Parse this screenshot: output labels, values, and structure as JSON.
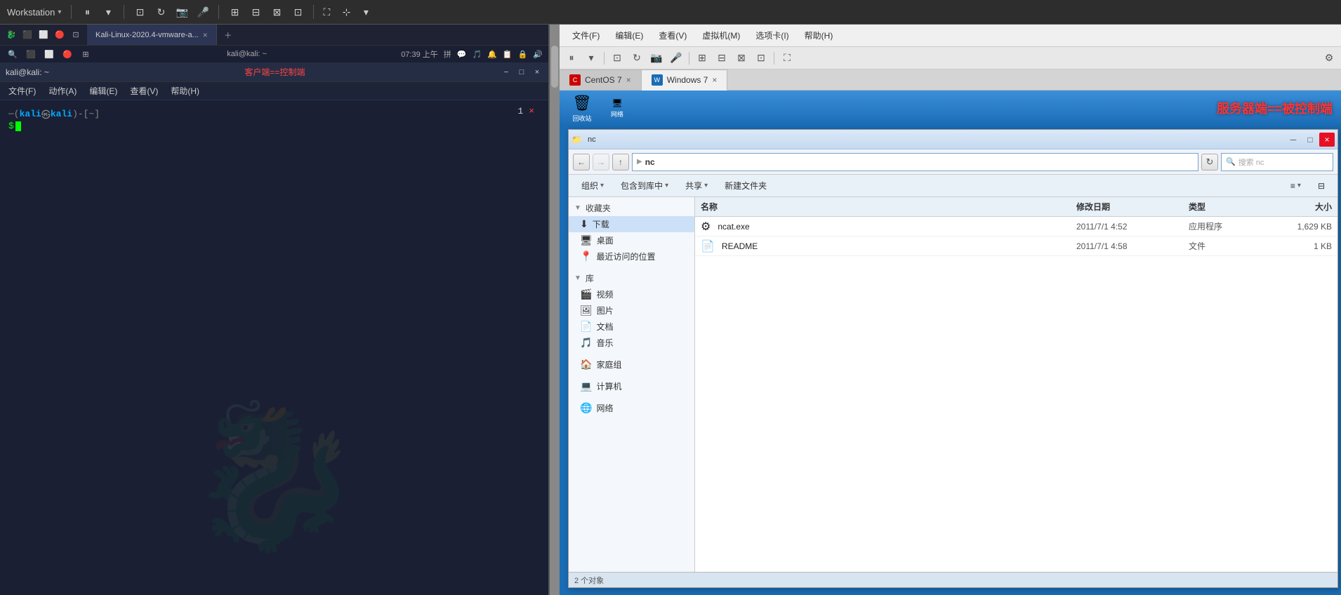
{
  "app": {
    "title": "Workstation",
    "dropdown_arrow": "▾"
  },
  "left_panel": {
    "tab_label": "Kali-Linux-2020.4-vmware-a...",
    "tab_close": "×",
    "status_bar": {
      "left_icons": [
        "⬛",
        "⬜",
        "⬜",
        "🔴"
      ],
      "time": "07:39 上午",
      "input_label": "拼",
      "right_icons": [
        "💬",
        "🎵",
        "🔔",
        "📋",
        "🔒",
        "🔊"
      ]
    },
    "window": {
      "title": "kali@kali: ~",
      "control_label": "客户端==控制端",
      "control_label_color": "#ff4444"
    },
    "menubar": {
      "items": [
        "文件(F)",
        "动作(A)",
        "编辑(E)",
        "查看(V)",
        "帮助(H)"
      ]
    },
    "terminal": {
      "prompt_bracket_open": "─(",
      "prompt_user": "kali",
      "prompt_at": "㉿",
      "prompt_host": "kali",
      "prompt_bracket_close": ")-[~]",
      "prompt_dollar": "$",
      "tab_num": "1",
      "tab_x": "×"
    }
  },
  "right_panel": {
    "menubar": {
      "items": [
        "文件(F)",
        "编辑(E)",
        "查看(V)",
        "虚拟机(M)",
        "选项卡(I)",
        "帮助(H)"
      ]
    },
    "tabs": [
      {
        "label": "CentOS 7",
        "active": false
      },
      {
        "label": "Windows 7",
        "active": true
      }
    ],
    "windows7": {
      "server_label": "服务器端==被控制端",
      "trash_icon": "🗑",
      "trash_label": "回收站",
      "network_icon": "🖥",
      "network_label": "网络"
    },
    "explorer": {
      "title": "",
      "address_path": "nc",
      "address_arrow": "▶",
      "search_placeholder": "搜索 nc",
      "toolbar_buttons": [
        "组织 ▾",
        "包含到库中 ▾",
        "共享 ▾",
        "新建文件夹"
      ],
      "columns": [
        "名称",
        "修改日期",
        "类型",
        "大小"
      ],
      "nav_items": [
        {
          "icon": "⭐",
          "label": "收藏夹",
          "section": true
        },
        {
          "icon": "⬇",
          "label": "下载"
        },
        {
          "icon": "🖥",
          "label": "桌面"
        },
        {
          "icon": "📍",
          "label": "最近访问的位置"
        },
        {
          "icon": "📚",
          "label": "库",
          "section": true
        },
        {
          "icon": "🎬",
          "label": "视频"
        },
        {
          "icon": "🖼",
          "label": "图片"
        },
        {
          "icon": "📄",
          "label": "文档"
        },
        {
          "icon": "🎵",
          "label": "音乐"
        },
        {
          "icon": "🏠",
          "label": "家庭组"
        },
        {
          "icon": "💻",
          "label": "计算机"
        },
        {
          "icon": "🌐",
          "label": "网络"
        }
      ],
      "files": [
        {
          "icon": "⚙",
          "name": "ncat.exe",
          "date": "2011/7/1 4:52",
          "type": "应用程序",
          "size": "1,629 KB"
        },
        {
          "icon": "📄",
          "name": "README",
          "date": "2011/7/1 4:58",
          "type": "文件",
          "size": "1 KB"
        }
      ]
    }
  },
  "scrollbar": {
    "color": "#888"
  }
}
